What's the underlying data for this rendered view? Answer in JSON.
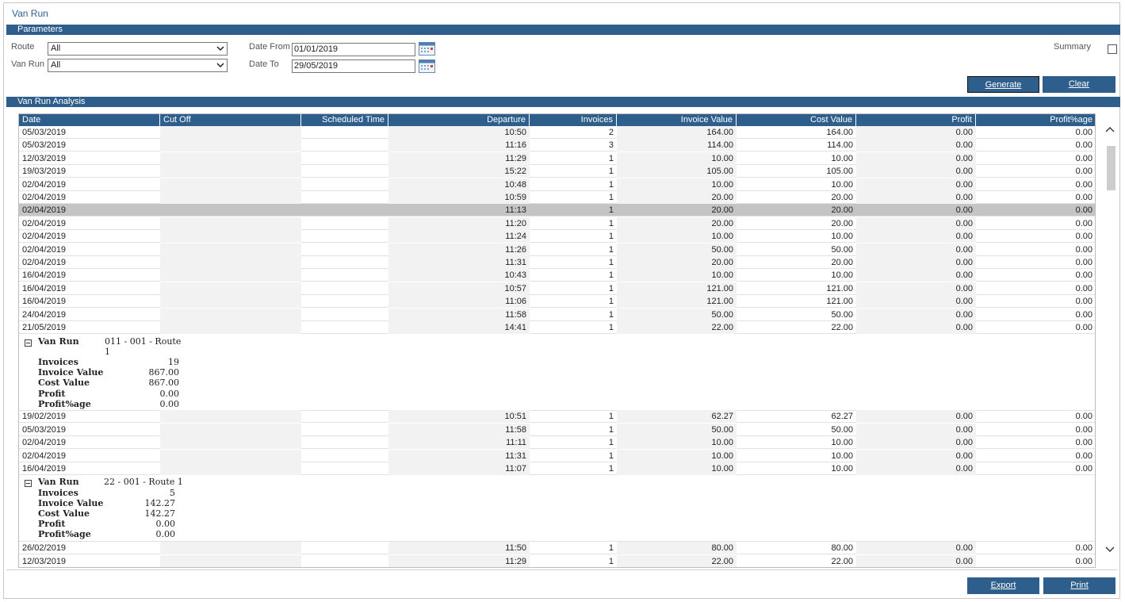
{
  "app": {
    "title": "Van Run"
  },
  "parameters": {
    "section_label": "Parameters",
    "route_label": "Route",
    "route_value": "All",
    "vanrun_label": "Van Run",
    "vanrun_value": "All",
    "date_from_label": "Date From",
    "date_from_value": "01/01/2019",
    "date_to_label": "Date To",
    "date_to_value": "29/05/2019",
    "summary_label": "Summary",
    "summary_checked": false,
    "generate_label": "Generate",
    "clear_label": "Clear"
  },
  "analysis": {
    "section_label": "Van Run Analysis",
    "columns": [
      "Date",
      "Cut Off",
      "Scheduled Time",
      "Departure",
      "Invoices",
      "Invoice Value",
      "Cost Value",
      "Profit",
      "Profit%age"
    ],
    "rows1": [
      [
        "05/03/2019",
        "",
        "",
        "10:50",
        "2",
        "164.00",
        "164.00",
        "0.00",
        "0.00"
      ],
      [
        "05/03/2019",
        "",
        "",
        "11:16",
        "3",
        "114.00",
        "114.00",
        "0.00",
        "0.00"
      ],
      [
        "12/03/2019",
        "",
        "",
        "11:29",
        "1",
        "10.00",
        "10.00",
        "0.00",
        "0.00"
      ],
      [
        "19/03/2019",
        "",
        "",
        "15:22",
        "1",
        "105.00",
        "105.00",
        "0.00",
        "0.00"
      ],
      [
        "02/04/2019",
        "",
        "",
        "10:48",
        "1",
        "10.00",
        "10.00",
        "0.00",
        "0.00"
      ],
      [
        "02/04/2019",
        "",
        "",
        "10:59",
        "1",
        "20.00",
        "20.00",
        "0.00",
        "0.00"
      ],
      [
        "02/04/2019",
        "",
        "",
        "11:13",
        "1",
        "20.00",
        "20.00",
        "0.00",
        "0.00"
      ],
      [
        "02/04/2019",
        "",
        "",
        "11:20",
        "1",
        "20.00",
        "20.00",
        "0.00",
        "0.00"
      ],
      [
        "02/04/2019",
        "",
        "",
        "11:24",
        "1",
        "10.00",
        "10.00",
        "0.00",
        "0.00"
      ],
      [
        "02/04/2019",
        "",
        "",
        "11:26",
        "1",
        "50.00",
        "50.00",
        "0.00",
        "0.00"
      ],
      [
        "02/04/2019",
        "",
        "",
        "11:31",
        "1",
        "20.00",
        "20.00",
        "0.00",
        "0.00"
      ],
      [
        "16/04/2019",
        "",
        "",
        "10:43",
        "1",
        "10.00",
        "10.00",
        "0.00",
        "0.00"
      ],
      [
        "16/04/2019",
        "",
        "",
        "10:57",
        "1",
        "121.00",
        "121.00",
        "0.00",
        "0.00"
      ],
      [
        "16/04/2019",
        "",
        "",
        "11:06",
        "1",
        "121.00",
        "121.00",
        "0.00",
        "0.00"
      ],
      [
        "24/04/2019",
        "",
        "",
        "11:58",
        "1",
        "50.00",
        "50.00",
        "0.00",
        "0.00"
      ],
      [
        "21/05/2019",
        "",
        "",
        "14:41",
        "1",
        "22.00",
        "22.00",
        "0.00",
        "0.00"
      ]
    ],
    "selected_row": 6,
    "group1": {
      "title_label": "Van Run",
      "title_value_line1": "011 - 001 - Route",
      "title_value_line2": "1",
      "invoices_label": "Invoices",
      "invoices_value": "19",
      "invoice_value_label": "Invoice Value",
      "invoice_value_value": "867.00",
      "cost_value_label": "Cost Value",
      "cost_value_value": "867.00",
      "profit_label": "Profit",
      "profit_value": "0.00",
      "profit_pct_label": "Profit%age",
      "profit_pct_value": "0.00"
    },
    "rows2": [
      [
        "19/02/2019",
        "",
        "",
        "10:51",
        "1",
        "62.27",
        "62.27",
        "0.00",
        "0.00"
      ],
      [
        "05/03/2019",
        "",
        "",
        "11:58",
        "1",
        "50.00",
        "50.00",
        "0.00",
        "0.00"
      ],
      [
        "02/04/2019",
        "",
        "",
        "11:11",
        "1",
        "10.00",
        "10.00",
        "0.00",
        "0.00"
      ],
      [
        "02/04/2019",
        "",
        "",
        "11:31",
        "1",
        "10.00",
        "10.00",
        "0.00",
        "0.00"
      ],
      [
        "16/04/2019",
        "",
        "",
        "11:07",
        "1",
        "10.00",
        "10.00",
        "0.00",
        "0.00"
      ]
    ],
    "group2": {
      "title_label": "Van Run",
      "title_value_line1": "22 - 001 - Route 1",
      "invoices_label": "Invoices",
      "invoices_value": "5",
      "invoice_value_label": "Invoice Value",
      "invoice_value_value": "142.27",
      "cost_value_label": "Cost Value",
      "cost_value_value": "142.27",
      "profit_label": "Profit",
      "profit_value": "0.00",
      "profit_pct_label": "Profit%age",
      "profit_pct_value": "0.00"
    },
    "rows3": [
      [
        "26/02/2019",
        "",
        "",
        "11:50",
        "1",
        "80.00",
        "80.00",
        "0.00",
        "0.00"
      ],
      [
        "12/03/2019",
        "",
        "",
        "11:29",
        "1",
        "22.00",
        "22.00",
        "0.00",
        "0.00"
      ]
    ]
  },
  "footer": {
    "export_label": "Export",
    "print_label": "Print"
  },
  "icons": [
    "calendar-icon",
    "dropdown-arrow-icon",
    "collapse-icon",
    "scroll-up-icon",
    "scroll-down-icon"
  ],
  "colors": {
    "accent": "#2e5f8c",
    "selected_row": "#c4c4c4"
  }
}
